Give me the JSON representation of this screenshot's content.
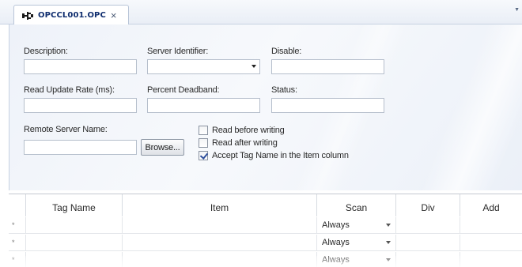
{
  "tab": {
    "title": "OPCCL001.OPC",
    "close_glyph": "×",
    "icon": "opc-driver-icon"
  },
  "form": {
    "description": {
      "label": "Description:",
      "value": ""
    },
    "server_identifier": {
      "label": "Server Identifier:",
      "value": ""
    },
    "disable": {
      "label": "Disable:",
      "value": ""
    },
    "read_update_rate": {
      "label": "Read Update Rate (ms):",
      "value": ""
    },
    "percent_deadband": {
      "label": "Percent Deadband:",
      "value": ""
    },
    "status": {
      "label": "Status:",
      "value": ""
    },
    "remote_server_name": {
      "label": "Remote Server Name:",
      "value": ""
    },
    "browse_button": "Browse...",
    "checkboxes": [
      {
        "label": "Read before writing",
        "checked": false
      },
      {
        "label": "Read after writing",
        "checked": false
      },
      {
        "label": "Accept Tag Name in the Item column",
        "checked": true
      }
    ]
  },
  "grid": {
    "columns": [
      "",
      "Tag Name",
      "Item",
      "Scan",
      "Div",
      "Add"
    ],
    "rows": [
      {
        "marker": "*",
        "tag_name": "",
        "item": "",
        "scan": "Always",
        "div": "",
        "add": ""
      },
      {
        "marker": "*",
        "tag_name": "",
        "item": "",
        "scan": "Always",
        "div": "",
        "add": ""
      },
      {
        "marker": "*",
        "tag_name": "",
        "item": "",
        "scan": "Always",
        "div": "",
        "add": ""
      }
    ]
  },
  "colors": {
    "tab_title": "#0f2d6e",
    "panel_bg": "#eef2f9",
    "checkbox_check": "#2e4f9c"
  }
}
